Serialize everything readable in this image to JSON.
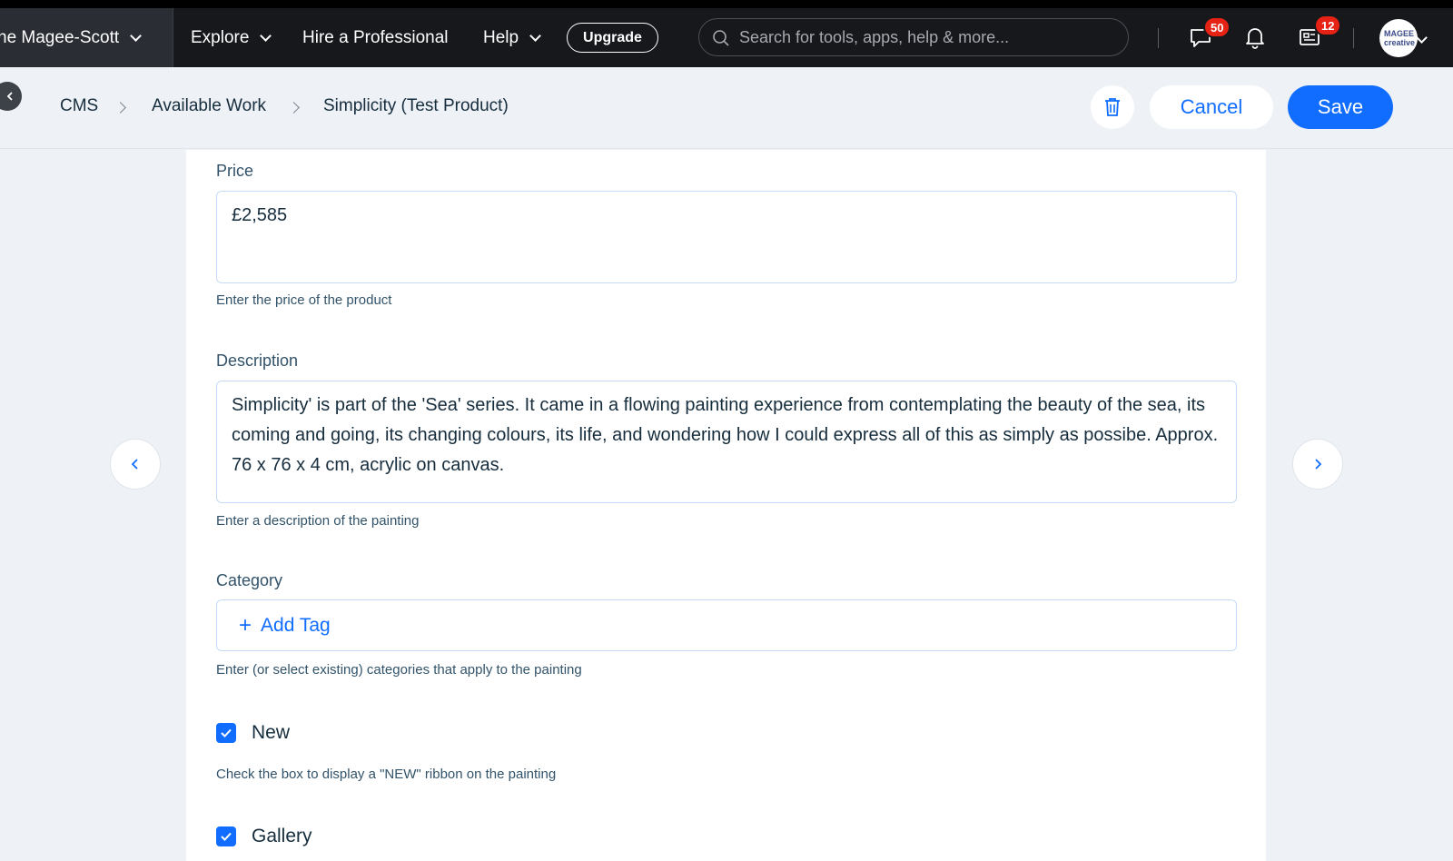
{
  "topbar": {
    "site_name": "ne Magee-Scott",
    "nav": {
      "explore": "Explore",
      "hire": "Hire a Professional",
      "help": "Help"
    },
    "upgrade": "Upgrade",
    "search_placeholder": "Search for tools, apps, help & more...",
    "messages_badge": "50",
    "notifications_badge": "12",
    "avatar_text": "MAGEE creative"
  },
  "breadcrumb": {
    "root": "CMS",
    "collection": "Available Work",
    "item": "Simplicity (Test Product)"
  },
  "actions": {
    "cancel": "Cancel",
    "save": "Save"
  },
  "form": {
    "price": {
      "label": "Price",
      "value": "£2,585",
      "help": "Enter the price of the product"
    },
    "description": {
      "label": "Description",
      "value": "Simplicity' is part of the 'Sea' series.  It came in a flowing painting experience from contemplating the beauty of the sea, its coming and going, its changing colours, its life, and wondering how I could express all of this as simply as possibe.  Approx. 76 x 76 x 4 cm, acrylic on canvas.",
      "help": "Enter a description of the painting"
    },
    "category": {
      "label": "Category",
      "add_tag": "Add Tag",
      "help": "Enter (or select existing) categories that apply to the painting"
    },
    "new": {
      "label": "New",
      "checked": true,
      "help": "Check the box to display a \"NEW\" ribbon on the painting"
    },
    "gallery": {
      "label": "Gallery",
      "checked": true
    }
  },
  "colors": {
    "accent": "#116dff",
    "topbar": "#16181c",
    "badge": "#e62214"
  }
}
